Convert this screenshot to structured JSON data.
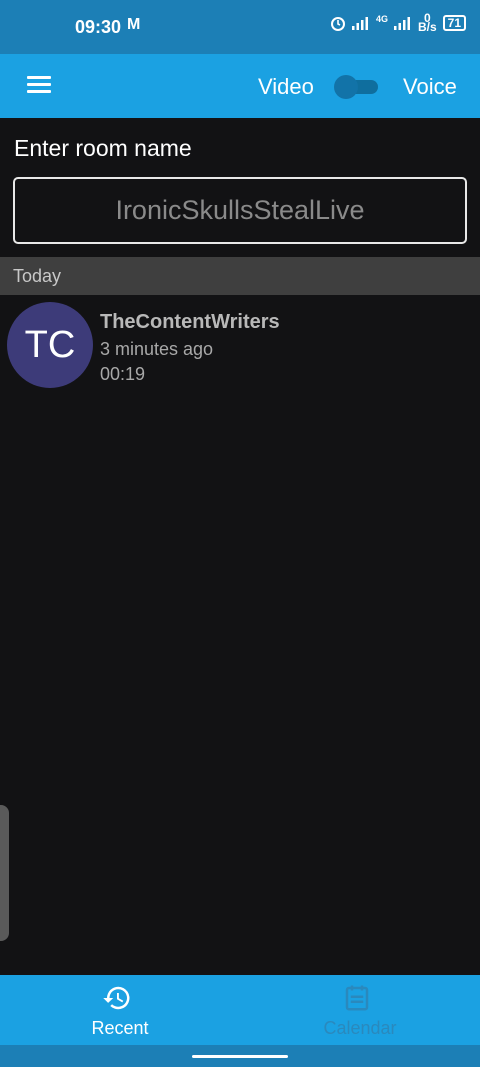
{
  "status_bar": {
    "time": "09:30",
    "mail_icon": "M",
    "network": "4G",
    "net_speed_value": "0",
    "net_speed_unit": "B/s",
    "battery": "71"
  },
  "app_bar": {
    "menu_icon": "hamburger-icon",
    "video_label": "Video",
    "voice_label": "Voice",
    "toggle_state": "off"
  },
  "room": {
    "label": "Enter room name",
    "placeholder": "IronicSkullsStealLive",
    "value": ""
  },
  "history": {
    "section_title": "Today",
    "items": [
      {
        "initials": "TC",
        "name": "TheContentWriters",
        "time_ago": "3 minutes ago",
        "duration": "00:19"
      }
    ]
  },
  "bottom_nav": {
    "tabs": [
      {
        "label": "Recent",
        "icon": "history-icon",
        "active": true
      },
      {
        "label": "Calendar",
        "icon": "calendar-icon",
        "active": false
      }
    ]
  },
  "colors": {
    "status_bar": "#1c7fb6",
    "accent": "#1ba1e2",
    "background": "#121214",
    "avatar": "#3d3b79"
  }
}
